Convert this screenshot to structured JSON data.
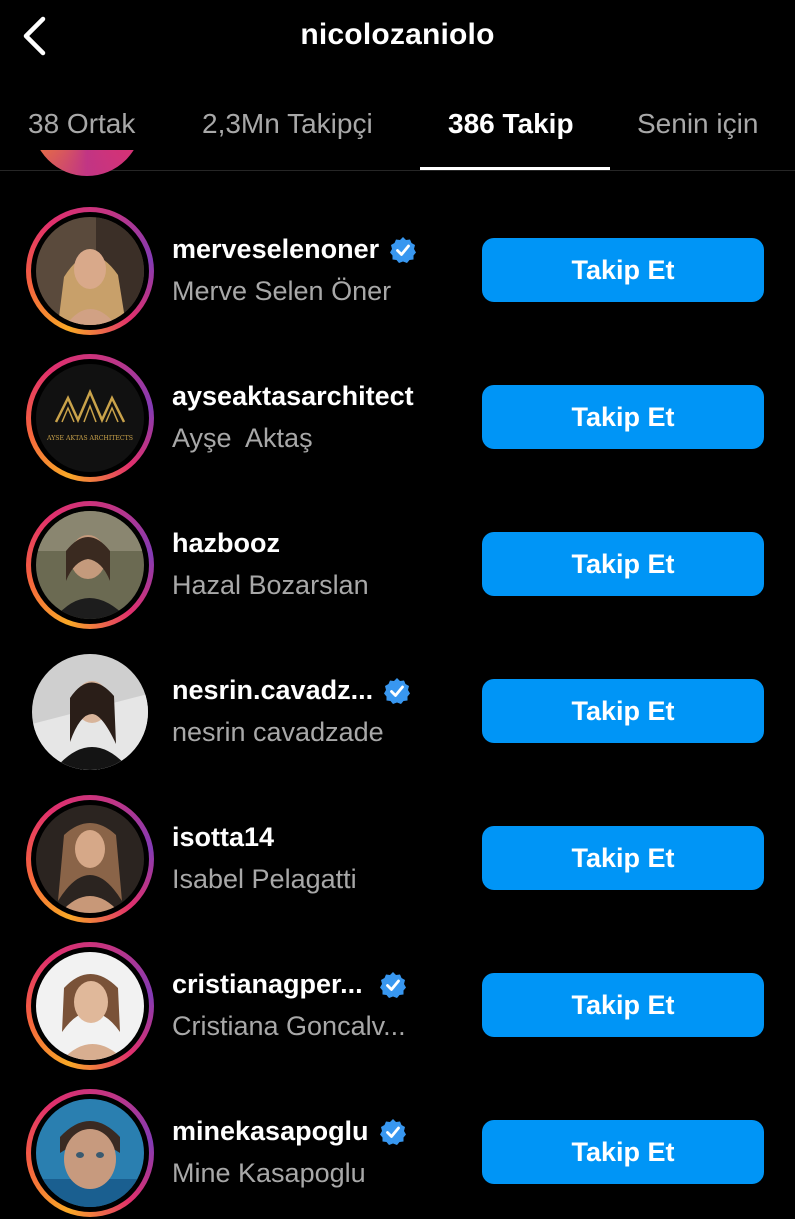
{
  "header": {
    "title": "nicolozaniolo",
    "back_icon": "chevron-left-icon"
  },
  "tabs": [
    {
      "label": "38 Ortak",
      "active": false
    },
    {
      "label": "2,3Mn Takipçi",
      "active": false
    },
    {
      "label": "386 Takip",
      "active": true
    },
    {
      "label": "Senin için",
      "active": false
    }
  ],
  "colors": {
    "accent": "#0095f6",
    "background": "#000000",
    "secondary_text": "#a8a8a8"
  },
  "users": [
    {
      "username": "merveselenoner",
      "full_name": "Merve Selen Öner",
      "verified": true,
      "button": "Takip Et",
      "story_ring": true
    },
    {
      "username": "ayseaktasarchitect",
      "full_name": "Ayşe  Aktaş",
      "verified": false,
      "button": "Takip Et",
      "story_ring": true,
      "logo_text": "AYSE AKTAS ARCHITECTS"
    },
    {
      "username": "hazbooz",
      "full_name": "Hazal Bozarslan",
      "verified": false,
      "button": "Takip Et",
      "story_ring": true
    },
    {
      "username": "nesrin.cavadz...",
      "full_name": "nesrin cavadzade",
      "verified": true,
      "button": "Takip Et",
      "story_ring": false
    },
    {
      "username": "isotta14",
      "full_name": "Isabel Pelagatti",
      "verified": false,
      "button": "Takip Et",
      "story_ring": true
    },
    {
      "username": "cristianagper...",
      "full_name": "Cristiana Goncalv...",
      "verified": true,
      "button": "Takip Et",
      "story_ring": true
    },
    {
      "username": "minekasapoglu",
      "full_name": "Mine Kasapoglu",
      "verified": true,
      "button": "Takip Et",
      "story_ring": true
    }
  ]
}
